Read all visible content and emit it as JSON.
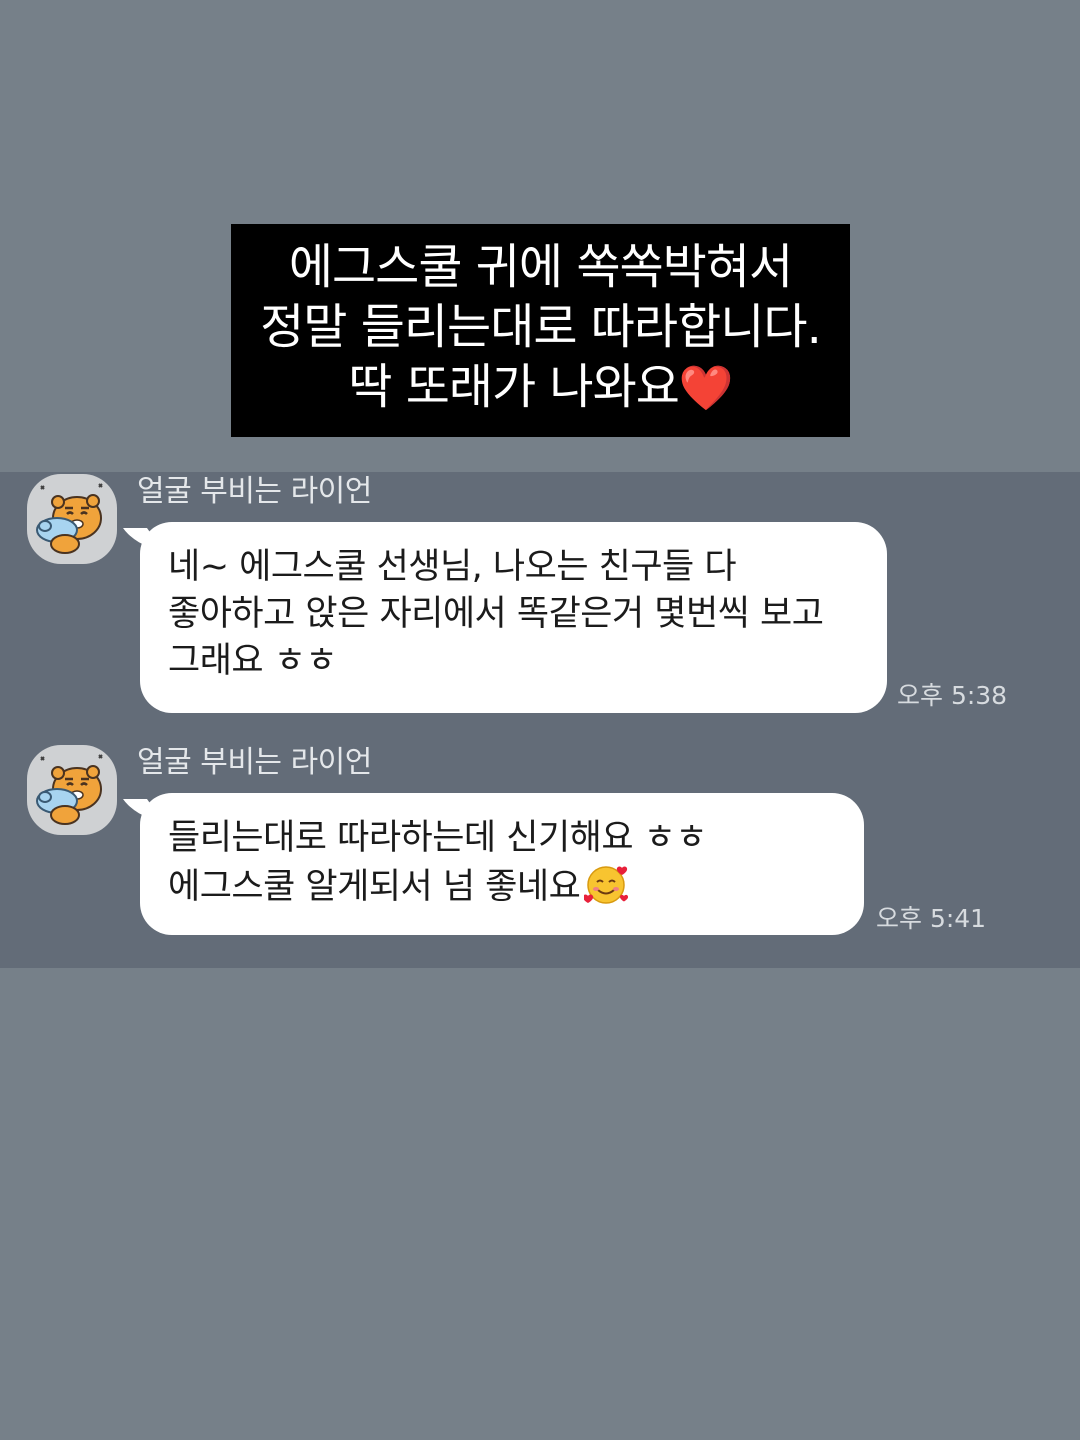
{
  "caption": {
    "lines": [
      "에그스쿨 귀에 쏙쏙박혀서",
      "정말 들리는대로 따라합니다.",
      "딱 또래가 나와요"
    ],
    "line3_emoji": "❤️"
  },
  "messages": [
    {
      "sender": "얼굴 부비는 라이언",
      "avatar_icon": "ryan-hugging-pillow-icon",
      "text": "네~ 에그스쿨 선생님, 나오는 친구들 다 좋아하고 앉은 자리에서 똑같은거 몇번씩 보고 그래요 ㅎㅎ",
      "time": "오후 5:38"
    },
    {
      "sender": "얼굴 부비는 라이언",
      "avatar_icon": "ryan-hugging-pillow-icon",
      "text": "들리는대로 따라하는데 신기해요 ㅎㅎ 에그스쿨 알게되서 넘 좋네요",
      "emoji": "smiling-face-with-hearts-icon",
      "time": "오후 5:41"
    }
  ],
  "colors": {
    "background": "#768089",
    "chat_band": "#636c78",
    "bubble": "#ffffff",
    "caption_box": "#000000"
  }
}
